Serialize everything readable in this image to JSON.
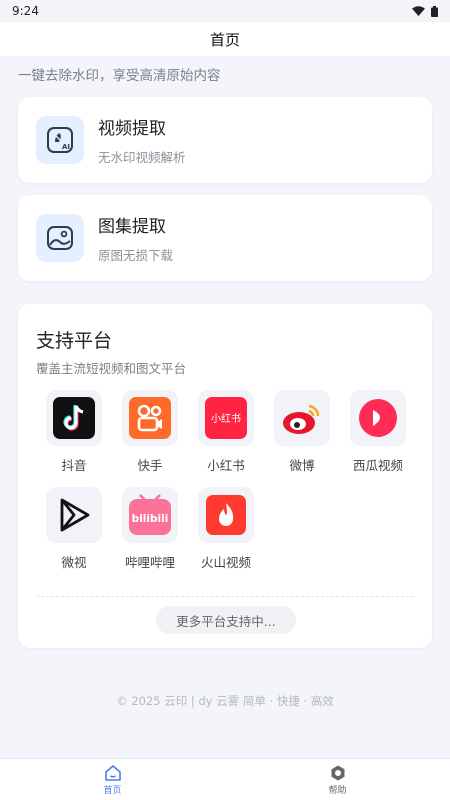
{
  "status_bar": {
    "time": "9:24"
  },
  "header": {
    "title": "首页"
  },
  "tagline": "一键去除水印，享受高清原始内容",
  "features": [
    {
      "title": "视频提取",
      "subtitle": "无水印视频解析",
      "icon": "video-ai-icon"
    },
    {
      "title": "图集提取",
      "subtitle": "原图无损下载",
      "icon": "gallery-icon"
    }
  ],
  "platforms": {
    "title": "支持平台",
    "subtitle": "覆盖主流短视频和图文平台",
    "items": [
      {
        "label": "抖音",
        "icon": "douyin-icon",
        "color": "#111111"
      },
      {
        "label": "快手",
        "icon": "kuaishou-icon",
        "color": "#ff6a2b"
      },
      {
        "label": "小红书",
        "icon": "xiaohongshu-icon",
        "color": "#ff2442",
        "icon_text": "小红书"
      },
      {
        "label": "微博",
        "icon": "weibo-icon",
        "color": "#e6162d"
      },
      {
        "label": "西瓜视频",
        "icon": "xigua-icon",
        "color": "#fe2c55"
      },
      {
        "label": "微视",
        "icon": "weishi-icon",
        "color": "#111111"
      },
      {
        "label": "哔哩哔哩",
        "icon": "bilibili-icon",
        "color": "#fb7299",
        "icon_text": "bilibili"
      },
      {
        "label": "火山视频",
        "icon": "huoshan-icon",
        "color": "#ff3b2f"
      }
    ],
    "more_label": "更多平台支持中..."
  },
  "footer": "© 2025 云印 | dy 云雾 简单 · 快捷 · 高效",
  "tabs": [
    {
      "label": "首页",
      "icon": "home-icon",
      "active": true
    },
    {
      "label": "帮助",
      "icon": "help-icon",
      "active": false
    }
  ],
  "colors": {
    "accent": "#4a7cf0",
    "feature_icon_bg": "#e6efff"
  }
}
